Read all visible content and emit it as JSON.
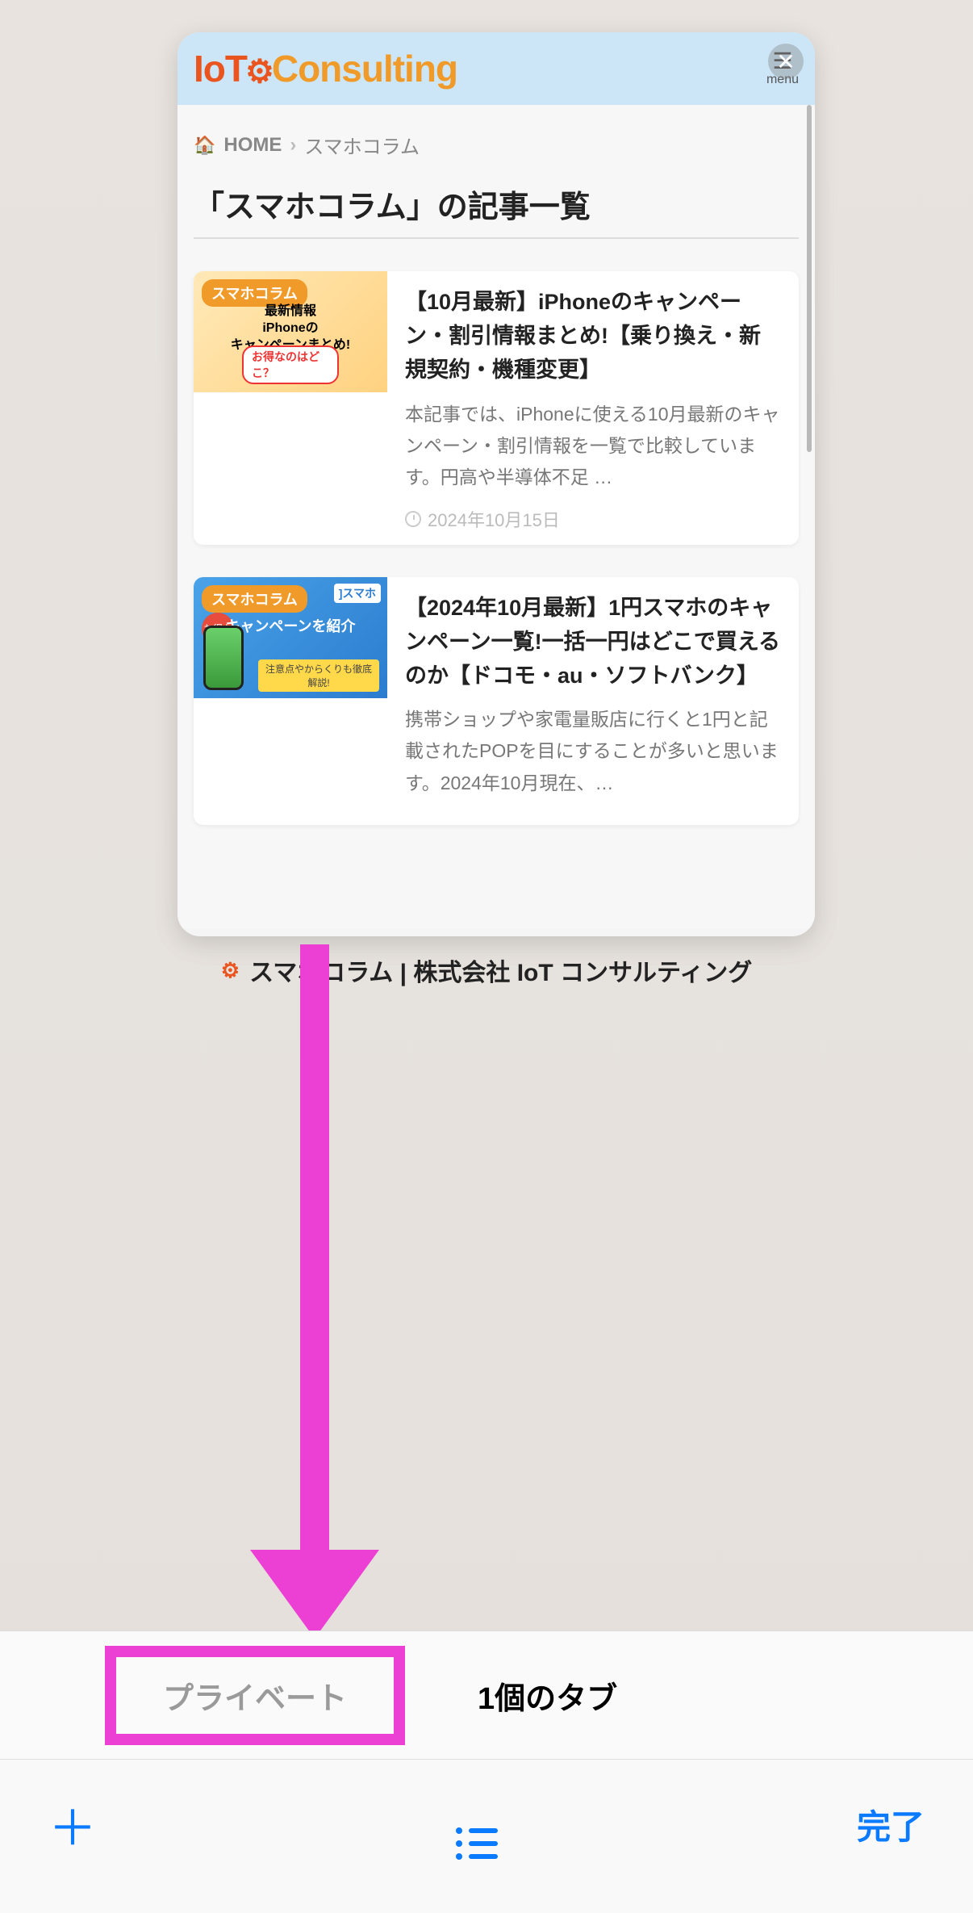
{
  "tab_card": {
    "logo": {
      "io": "IoT",
      "consulting": "Consulting"
    },
    "menu_label": "menu",
    "breadcrumb": {
      "home_label": "HOME",
      "current": "スマホコラム"
    },
    "page_title": "「スマホコラム」の記事一覧",
    "articles": [
      {
        "badge": "スマホコラム",
        "thumb_line1": "最新情報",
        "thumb_line2": "iPhoneの",
        "thumb_line3": "キャンペーンまとめ!",
        "thumb_red": "お得なのはどこ？",
        "title": "【10月最新】iPhoneのキャンペーン・割引情報まとめ!【乗り換え・新規契約・機種変更】",
        "desc": "本記事では、iPhoneに使える10月最新のキャンペーン・割引情報を一覧で比較しています。円高や半導体不足 …",
        "date": "2024年10月15日"
      },
      {
        "badge": "スマホコラム",
        "thumb_logo": "]スマホ",
        "thumb_red_dot": "お得な",
        "thumb_line": "キャンペーンを紹介",
        "thumb_yellow": "注意点やからくりも徹底解説!",
        "title": "【2024年10月最新】1円スマホのキャンペーン一覧!一括一円はどこで買えるのか【ドコモ・au・ソフトバンク】",
        "desc": "携帯ショップや家電量販店に行くと1円と記載されたPOPを目にすることが多いと思います。2024年10月現在、…"
      }
    ]
  },
  "tab_caption": "スマホコラム | 株式会社 IoT コンサルティング",
  "segmented": {
    "private_label": "プライベート",
    "tabs_label": "1個のタブ"
  },
  "toolbar": {
    "done_label": "完了"
  }
}
